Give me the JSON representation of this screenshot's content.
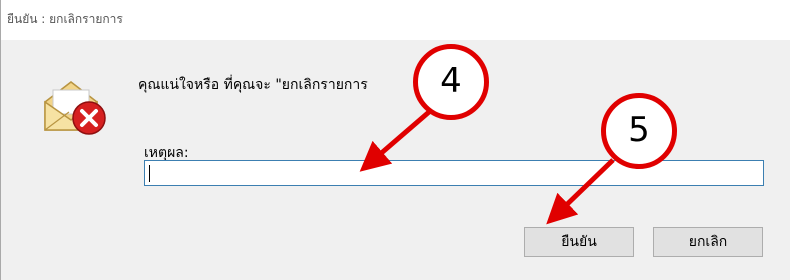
{
  "window": {
    "title": "ยืนยัน : ยกเลิกรายการ"
  },
  "dialog": {
    "icon": "mail-error-icon",
    "question": "คุณแน่ใจหรือ ที่คุณจะ \"ยกเลิกรายการ",
    "reason_label": "เหตุผล:",
    "reason_value": ""
  },
  "buttons": {
    "confirm": "ยืนยัน",
    "cancel": "ยกเลิก"
  },
  "annotations": {
    "callout_4": "4",
    "callout_5": "5",
    "color": "#e00000"
  }
}
